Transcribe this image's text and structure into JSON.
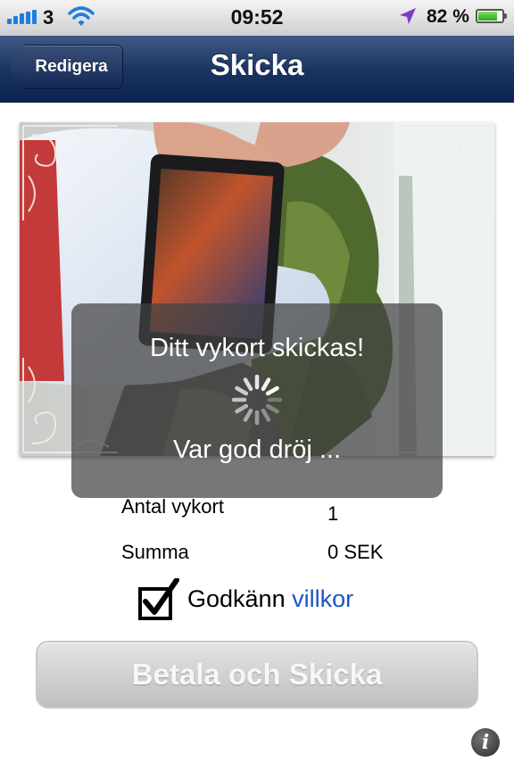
{
  "status_bar": {
    "carrier": "3",
    "time": "09:52",
    "battery_percent": "82 %",
    "battery_level": 0.82,
    "signal_icon": "signal-bars-icon",
    "wifi_icon": "wifi-icon",
    "location_icon": "location-arrow-icon",
    "battery_icon": "battery-icon"
  },
  "nav": {
    "back_label": "Redigera",
    "title": "Skicka"
  },
  "details": {
    "count_label": "Antal vykort",
    "count_value": "1",
    "sum_label": "Summa",
    "sum_value": "0 SEK"
  },
  "terms": {
    "checked": true,
    "label": "Godkänn",
    "link": "villkor"
  },
  "pay_button": {
    "label": "Betala och Skicka",
    "enabled": false
  },
  "hud": {
    "title": "Ditt vykort skickas!",
    "message": "Var god dröj ..."
  },
  "colors": {
    "nav_bar": "#1a3260",
    "link": "#1a56c4",
    "hud_background": "#424242"
  }
}
